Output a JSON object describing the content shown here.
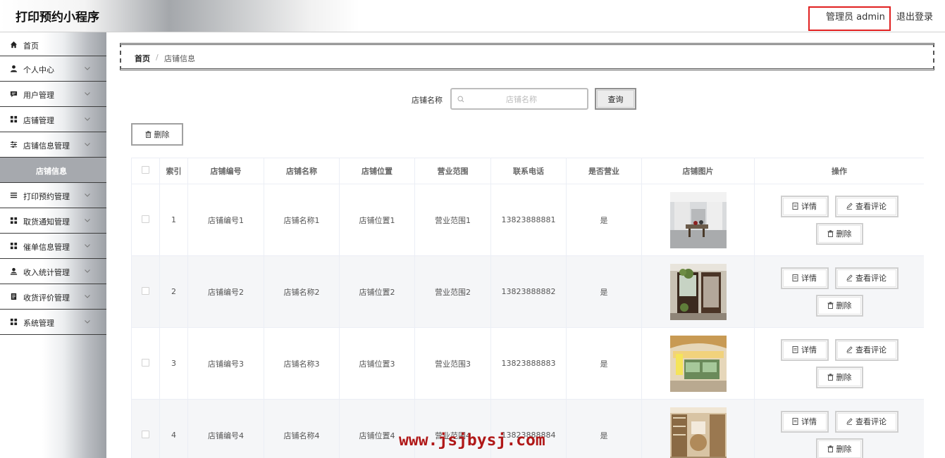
{
  "header": {
    "app_title": "打印预约小程序",
    "admin_label": "管理员 admin",
    "logout_label": "退出登录",
    "highlight_color": "#e02020"
  },
  "sidebar": {
    "items": [
      {
        "label": "首页",
        "icon": "home-icon",
        "has_chevron": false
      },
      {
        "label": "个人中心",
        "icon": "user-icon",
        "has_chevron": true
      },
      {
        "label": "用户管理",
        "icon": "chat-icon",
        "has_chevron": true
      },
      {
        "label": "店铺管理",
        "icon": "grid-icon",
        "has_chevron": true
      },
      {
        "label": "店铺信息管理",
        "icon": "sliders-icon",
        "has_chevron": true,
        "expanded": true
      },
      {
        "label": "打印预约管理",
        "icon": "list-icon",
        "has_chevron": true
      },
      {
        "label": "取货通知管理",
        "icon": "grid-icon",
        "has_chevron": true
      },
      {
        "label": "催单信息管理",
        "icon": "grid-icon",
        "has_chevron": true
      },
      {
        "label": "收入统计管理",
        "icon": "person-stat-icon",
        "has_chevron": true
      },
      {
        "label": "收货评价管理",
        "icon": "document-icon",
        "has_chevron": true
      },
      {
        "label": "系统管理",
        "icon": "grid-icon",
        "has_chevron": true
      }
    ],
    "active_submenu": "店铺信息"
  },
  "breadcrumb": {
    "home": "首页",
    "separator": "/",
    "current": "店铺信息"
  },
  "search": {
    "label": "店铺名称",
    "placeholder": "店铺名称",
    "value": "",
    "button": "查询"
  },
  "toolbar": {
    "delete_label": "删除"
  },
  "table": {
    "columns": [
      "索引",
      "店铺编号",
      "店铺名称",
      "店铺位置",
      "营业范围",
      "联系电话",
      "是否营业",
      "店铺图片",
      "操作"
    ],
    "rows": [
      {
        "index": "1",
        "code": "店铺编号1",
        "name": "店铺名称1",
        "location": "店铺位置1",
        "scope": "营业范围1",
        "phone": "13823888881",
        "open": "是",
        "image": "store-photo-gray-interior"
      },
      {
        "index": "2",
        "code": "店铺编号2",
        "name": "店铺名称2",
        "location": "店铺位置2",
        "scope": "营业范围2",
        "phone": "13823888882",
        "open": "是",
        "image": "store-photo-shopfront"
      },
      {
        "index": "3",
        "code": "店铺编号3",
        "name": "店铺名称3",
        "location": "店铺位置3",
        "scope": "营业范围3",
        "phone": "13823888883",
        "open": "是",
        "image": "store-photo-kiosk"
      },
      {
        "index": "4",
        "code": "店铺编号4",
        "name": "店铺名称4",
        "location": "店铺位置4",
        "scope": "营业范围4",
        "phone": "13823888884",
        "open": "是",
        "image": "store-photo-bakery"
      }
    ],
    "actions": {
      "detail": "详情",
      "comments": "查看评论",
      "delete": "删除"
    }
  },
  "watermark": "www.jsjbysj.com"
}
